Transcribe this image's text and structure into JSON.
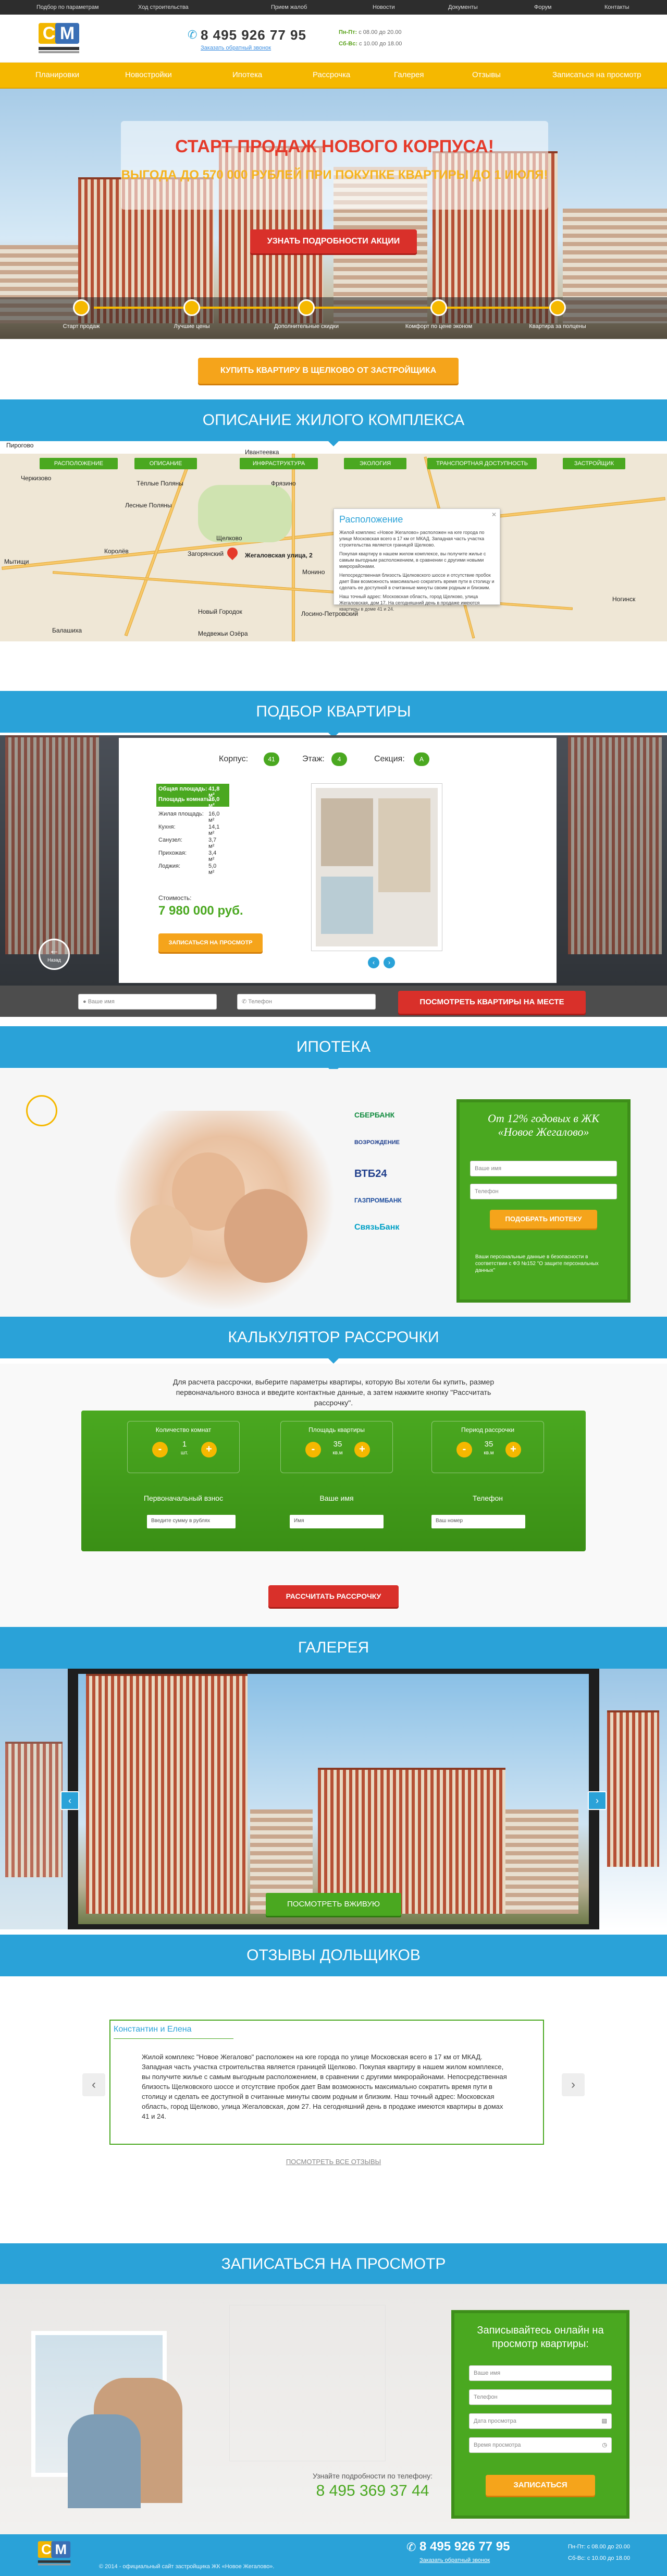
{
  "topnav": {
    "items": [
      "Подбор по параметрам",
      "Ход строительства",
      "Прием жалоб",
      "Новости",
      "Документы",
      "Форум",
      "Контакты"
    ]
  },
  "header": {
    "logo_text": "СМ",
    "phone": "8 495 926 77 95",
    "callback": "Заказать обратный звонок",
    "hours_label1": "Пн-Пт:",
    "hours_value1": "с 08.00 до 20.00",
    "hours_label2": "Сб-Вс:",
    "hours_value2": "с 10.00 до 18.00"
  },
  "menu": {
    "items": [
      "Планировки",
      "Новостройки",
      "Ипотека",
      "Рассрочка",
      "Галерея",
      "Отзывы",
      "Записаться на просмотр"
    ]
  },
  "hero": {
    "title": "Старт продаж нового корпуса!",
    "subtitle": "Выгода до 570 000 рублей при покупке квартиры до 1 июля!",
    "cta": "Узнать подробности акции",
    "steps": [
      "Старт продаж",
      "Лучшие цены",
      "Дополнительные скидки",
      "Комфорт по цене эконом",
      "Квартира за полцены"
    ]
  },
  "buy_btn": "Купить квартиру в Щелково от застройщика",
  "description": {
    "title": "Описание жилого комплекса",
    "tabs": [
      "Расположение",
      "Описание",
      "Инфраструктура",
      "Экология",
      "Транспортная доступность",
      "Застройщик"
    ],
    "map_labels": [
      "Пирогово",
      "Черкизово",
      "Ивантеевка",
      "Фрязино",
      "Тёплые Поляны",
      "Лесные Поляны",
      "Мытищи",
      "Королёв",
      "Щелково",
      "Загорянский",
      "Жегаловская улица, 2",
      "Новый Городок",
      "Лосино-Петровский",
      "Монино",
      "Ногинск",
      "Медвежьи Озёра",
      "Балашиха"
    ],
    "info_title": "Расположение",
    "info_p1": "Жилой комплекс «Новое Жегалово» расположен на юге города по улице Московская всего в 17 км от МКАД. Западная часть участка строительства является границей Щелково.",
    "info_p2": "Покупая квартиру в нашем жилом комплексе, вы получите жилье с самым выгодным расположением, в сравнении с другими новыми микрорайонами.",
    "info_p3": "Непосредственная близость Щелковского шоссе и отсутствие пробок дает Вам возможность максимально сократить время пути в столицу и сделать ее доступной в считанные минуты своим родным и близким.",
    "info_p4": "Наш точный адрес: Московская область, город Щелково, улица Жегаловская, дом 17. На сегодняшний день в продаже имеются квартиры в доме 41 и 24."
  },
  "apartment": {
    "title": "Подбор квартиры",
    "korpus_label": "Корпус:",
    "korpus_value": "41",
    "etazh_label": "Этаж:",
    "etazh_value": "4",
    "sekcia_label": "Секция:",
    "sekcia_value": "А",
    "rows": [
      [
        "Общая площадь:",
        "41,8 м²"
      ],
      [
        "Площадь комнаты:",
        "16,0 м²"
      ],
      [
        "Жилая площадь:",
        "16,0 м²"
      ],
      [
        "Кухня:",
        "14,1 м²"
      ],
      [
        "Санузел:",
        "3,7 м²"
      ],
      [
        "Прихожая:",
        "3,4 м²"
      ],
      [
        "Лоджия:",
        "5,0 м²"
      ]
    ],
    "price_label": "Стоимость:",
    "price": "7 980 000 руб.",
    "sign_btn": "Записаться на просмотр",
    "back_label": "Назад",
    "name_ph": "Ваше имя",
    "phone_ph": "Телефон",
    "watch_btn": "Посмотреть квартиры на месте"
  },
  "mortgage": {
    "title": "Ипотека",
    "banks": [
      "СБЕРБАНК",
      "ВОЗРОЖДЕНИЕ",
      "ВТБ24",
      "ГАЗПРОМБАНК",
      "СвязьБанк"
    ],
    "offer": "От 12% годовых в ЖК «Новое Жегалово»",
    "name_ph": "Ваше имя",
    "phone_ph": "Телефон",
    "btn": "Подобрать ипотеку",
    "note": "Ваши персональные данные в безопасности в соответствии с ФЗ №152 \"О защите персональных данных\""
  },
  "calc": {
    "title": "Калькулятор рассрочки",
    "intro": "Для расчета рассрочки, выберите параметры квартиры, которую Вы хотели бы купить, размер первоначального взноса и введите контактные данные, а затем нажмите кнопку \"Рассчитать рассрочку\".",
    "rooms_label": "Количество комнат",
    "rooms_value": "1",
    "rooms_unit": "шт.",
    "area_label": "Площадь квартиры",
    "area_value": "35",
    "area_unit": "кв.м",
    "period_label": "Период рассрочки",
    "period_value": "35",
    "period_unit": "кв.м",
    "initial_label": "Первоначальный взнос",
    "initial_ph": "Введите сумму в рублях",
    "name_label": "Ваше имя",
    "name_ph": "Имя",
    "phone_label": "Телефон",
    "phone_ph": "Ваш номер",
    "btn": "Рассчитать рассрочку"
  },
  "gallery": {
    "title": "Галерея",
    "btn": "Посмотреть вживую"
  },
  "reviews": {
    "title": "Отзывы дольщиков",
    "author": "Константин и Елена",
    "text": "Жилой комплекс \"Новое Жегалово\" расположен на юге города по улице Московская всего в 17 км от МКАД. Западная часть участка строительства является границей Щелково. Покупая квартиру в нашем жилом комплексе, вы получите жилье с самым выгодным расположением, в сравнении с другими микрорайонами. Непосредственная близость Щелковского шоссе и отсутствие пробок дает Вам возможность максимально сократить время пути в столицу и сделать ее доступной в считанные минуты своим родным и близким. Наш точный адрес: Московская область, город Щелково, улица Жегаловская, дом 27. На сегодняшний день в продаже имеются квартиры в домах 41 и 24.",
    "all": "Посмотреть все отзывы"
  },
  "booking": {
    "title": "Записаться на просмотр",
    "form_title": "Записывайтесь онлайн на просмотр квартиры:",
    "name_ph": "Ваше имя",
    "phone_ph": "Телефон",
    "date_ph": "Дата просмотра",
    "time_ph": "Время просмотра",
    "btn": "Записаться",
    "phone_hint": "Узнайте подробности по телефону:",
    "phone": "8 495 369 37 44"
  },
  "footer": {
    "copyright": "© 2014 - официальный сайт застройщика ЖК «Новое Жегалово».",
    "phone": "8 495 926 77 95",
    "callback": "Заказать обратный звонок",
    "hours1": "Пн-Пт: с 08.00 до 20.00",
    "hours2": "Сб-Вс: с 10.00 до 18.00"
  }
}
